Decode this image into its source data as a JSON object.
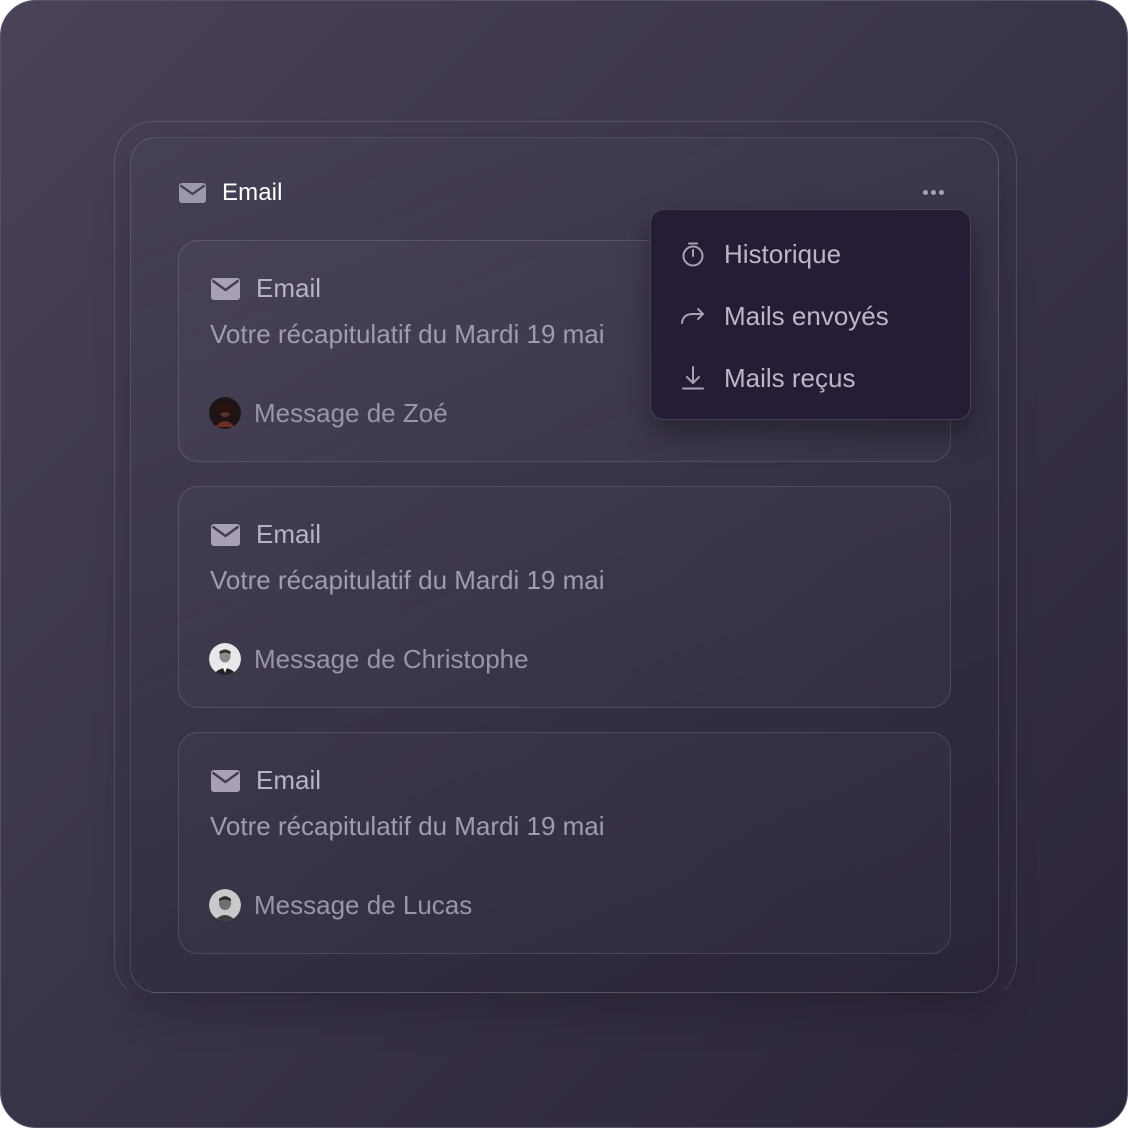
{
  "panel": {
    "title": "Email",
    "icon": "mail-icon",
    "more_icon": "more-horizontal-icon"
  },
  "dropdown_menu": {
    "items": [
      {
        "label": "Historique",
        "icon": "stopwatch-icon"
      },
      {
        "label": "Mails envoyés",
        "icon": "forward-arrow-icon"
      },
      {
        "label": "Mails reçus",
        "icon": "download-icon"
      }
    ]
  },
  "cards": [
    {
      "label": "Email",
      "subject": "Votre récapitulatif du Mardi 19 mai",
      "sender": "Message de Zoé",
      "icon": "mail-icon",
      "avatar": "avatar-zoe"
    },
    {
      "label": "Email",
      "subject": "Votre récapitulatif du Mardi 19 mai",
      "sender": "Message de Christophe",
      "icon": "mail-icon",
      "avatar": "avatar-christophe"
    },
    {
      "label": "Email",
      "subject": "Votre récapitulatif du Mardi 19 mai",
      "sender": "Message de Lucas",
      "icon": "mail-icon",
      "avatar": "avatar-lucas"
    }
  ],
  "colors": {
    "background_start": "#4a4256",
    "background_end": "#2c2539",
    "dropdown_bg": "#251c35",
    "title_text": "#ffffff",
    "muted_text": "#a19cad"
  }
}
